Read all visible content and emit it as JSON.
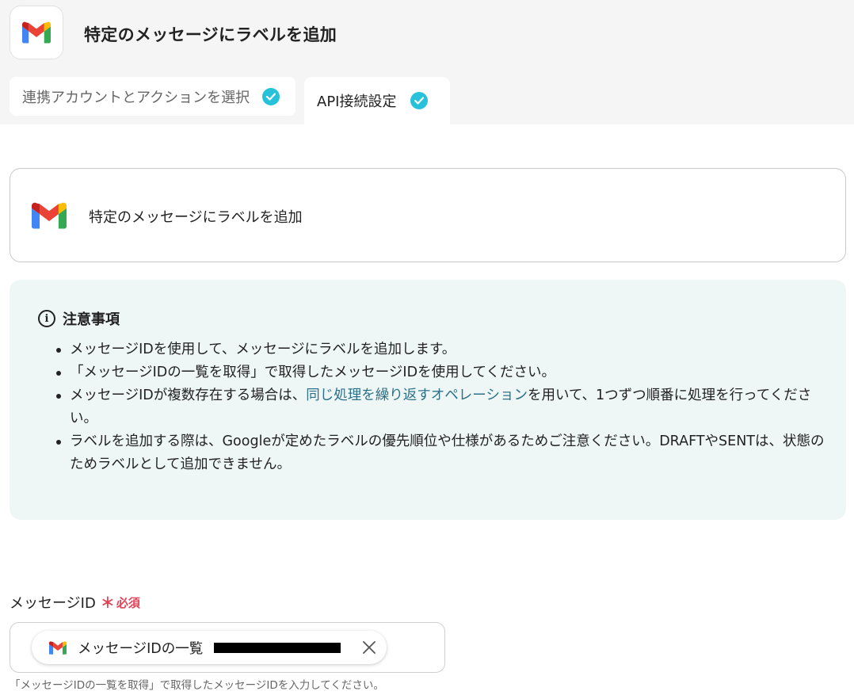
{
  "header": {
    "title": "特定のメッセージにラベルを追加",
    "app_icon": "gmail-icon"
  },
  "tabs": [
    {
      "label": "連携アカウントとアクションを選択",
      "completed": true
    },
    {
      "label": "API接続設定",
      "completed": true
    }
  ],
  "action_card": {
    "title": "特定のメッセージにラベルを追加"
  },
  "notice": {
    "heading": "注意事項",
    "items": [
      {
        "text": "メッセージIDを使用して、メッセージにラベルを追加します。"
      },
      {
        "text": "「メッセージIDの一覧を取得」で取得したメッセージIDを使用してください。"
      },
      {
        "before": "メッセージIDが複数存在する場合は、",
        "link": "同じ処理を繰り返すオペレーション",
        "after": "を用いて、1つずつ順番に処理を行ってください。"
      },
      {
        "text": "ラベルを追加する際は、Googleが定めたラベルの優先順位や仕様があるためご注意ください。DRAFTやSENTは、状態のためラベルとして追加できません。"
      }
    ]
  },
  "field": {
    "label": "メッセージID",
    "required_mark": "＊",
    "required_text": "必須",
    "chip_label": "メッセージIDの一覧",
    "helper": "「メッセージIDの一覧を取得」で取得したメッセージIDを入力してください。"
  },
  "colors": {
    "check": "#27c2d9",
    "link": "#2d7088",
    "required": "#e0455a",
    "notice_bg": "#eef7f6"
  }
}
